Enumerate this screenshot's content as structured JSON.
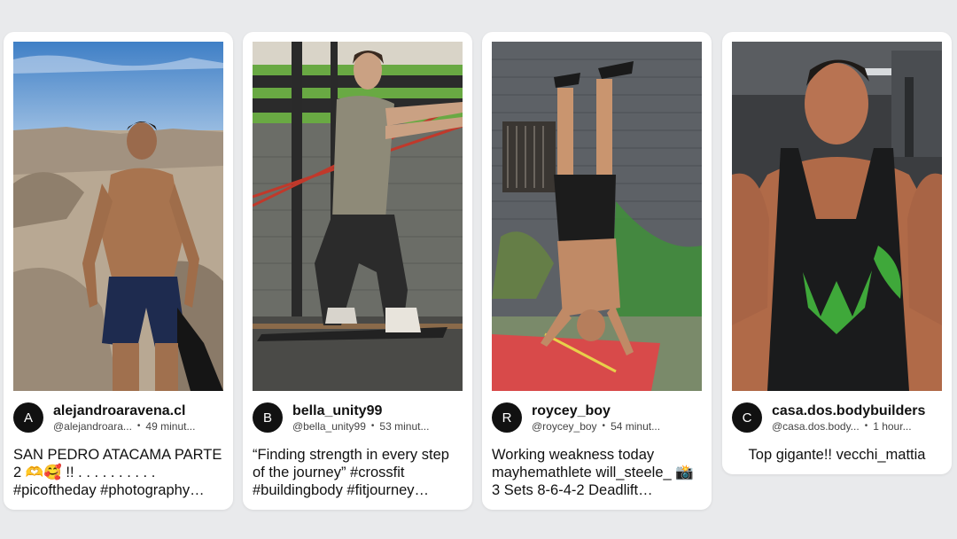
{
  "posts": [
    {
      "avatar_letter": "A",
      "name": "alejandroaravena.cl",
      "handle": "@alejandroara...",
      "time": "49 minut...",
      "caption": "SAN PEDRO ATACAMA PARTE 2 🫶🥰 !! . . . . . . . . . . #picoftheday #photography…"
    },
    {
      "avatar_letter": "B",
      "name": "bella_unity99",
      "handle": "@bella_unity99",
      "time": "53 minut...",
      "caption": "“Finding strength in every step of the journey” #crossfit #buildingbody #fitjourney…"
    },
    {
      "avatar_letter": "R",
      "name": "roycey_boy",
      "handle": "@roycey_boy",
      "time": "54 minut...",
      "caption": "Working weakness today mayhemathlete will_steele_ 📸 3 Sets 8-6-4-2 Deadlift…"
    },
    {
      "avatar_letter": "C",
      "name": "casa.dos.bodybuilders",
      "handle": "@casa.dos.body...",
      "time": "1 hour...",
      "caption": "Top gigante!! vecchi_mattia"
    }
  ],
  "dot": "•"
}
